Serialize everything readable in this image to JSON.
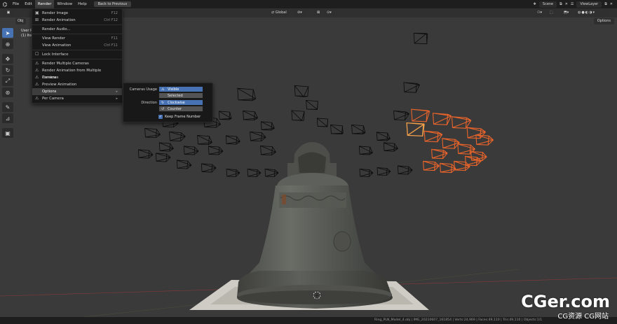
{
  "topbar": {
    "menus": [
      "File",
      "Edit",
      "Render",
      "Window",
      "Help"
    ],
    "active_menu": "Render",
    "back_button": "Back to Previous",
    "scene_label": "Scene",
    "view_layer_label": "ViewLayer"
  },
  "viewport_header": {
    "object_mode": "Obj",
    "transform_orientation": "Global",
    "options_label": "Options"
  },
  "viewport_info": {
    "line1": "User P",
    "line2": "(1) Ite"
  },
  "render_menu": {
    "items": [
      {
        "label": "Render Image",
        "shortcut": "F12",
        "icon": "image-icon"
      },
      {
        "label": "Render Animation",
        "shortcut": "Ctrl F12",
        "icon": "film-icon"
      },
      {
        "label": "Render Audio...",
        "shortcut": "",
        "icon": ""
      },
      {
        "label": "View Render",
        "shortcut": "F11",
        "icon": ""
      },
      {
        "label": "View Animation",
        "shortcut": "Ctrl F11",
        "icon": ""
      },
      {
        "label": "Lock Interface",
        "shortcut": "",
        "icon": "checkbox-icon"
      },
      {
        "label": "Render Multiple Cameras",
        "shortcut": "",
        "icon": "camera-icon"
      },
      {
        "label": "Render Animation from Multiple Cameras",
        "shortcut": "",
        "icon": "camera-icon"
      },
      {
        "label": "Preview",
        "shortcut": "",
        "icon": "camera-icon"
      },
      {
        "label": "Preview Animation",
        "shortcut": "",
        "icon": "camera-icon"
      },
      {
        "label": "Options",
        "shortcut": "",
        "icon": "",
        "submenu": true
      },
      {
        "label": "Per Camera",
        "shortcut": "",
        "icon": "camera-icon",
        "submenu": true
      }
    ]
  },
  "options_submenu": {
    "cameras_usage_label": "Cameras Usage",
    "cameras_usage_options": [
      "Visible",
      "Selected"
    ],
    "cameras_usage_selected": "Visible",
    "direction_label": "Direction",
    "direction_options": [
      "Clockwise",
      "Counter"
    ],
    "direction_selected": "Clockwise",
    "keep_frame_label": "Keep Frame Number",
    "keep_frame_checked": true
  },
  "statusbar": {
    "text": "Ring_PLN_Model_4.obj | IMG_20210607_161854 | Verts:24,969 | Faces:49,110 | Tris:49,110 | Objects:1/1"
  },
  "watermark": {
    "main": "CGer.com",
    "sub": "CG资源 CG网站"
  },
  "colors": {
    "accent": "#4772b3",
    "selected_camera": "#e8642a",
    "active_camera": "#f2a04a",
    "camera_wire": "#0a0a0a",
    "background": "#3a3a3a"
  }
}
